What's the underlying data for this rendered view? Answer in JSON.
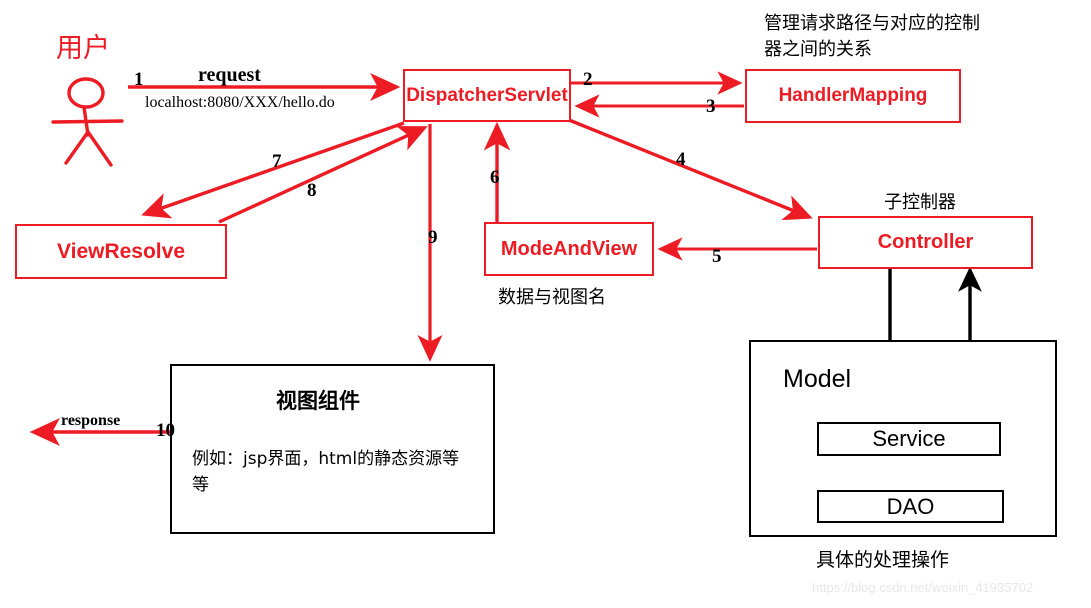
{
  "diagram": {
    "title_watermark": "https://blog.csdn.net/weixin_41935702",
    "colors": {
      "red": "#ED1C24",
      "black": "#000000",
      "background": "#FFFFFF",
      "watermark": "#E8E8E8"
    },
    "actor": {
      "label": "用户",
      "icon": "stick-figure"
    },
    "nodes": {
      "dispatcher_servlet": "DispatcherServlet",
      "handler_mapping": "HandlerMapping",
      "view_resolve": "ViewResolve",
      "mode_and_view": "ModeAndView",
      "controller": "Controller",
      "model": "Model",
      "service": "Service",
      "dao": "DAO",
      "view_component": "视图组件",
      "view_component_desc": "例如：jsp界面，html的静态资源等等"
    },
    "notes": {
      "handler_mapping": "管理请求路径与对应的控制器之间的关系",
      "controller": "子控制器",
      "mode_and_view": "数据与视图名",
      "model": "具体的处理操作",
      "request_url": "localhost:8080/XXX/hello.do"
    },
    "edges": {
      "request_word": "request",
      "response_word": "response",
      "n1": "1",
      "n2": "2",
      "n3": "3",
      "n4": "4",
      "n5": "5",
      "n6": "6",
      "n7": "7",
      "n8": "8",
      "n9": "9",
      "n10": "10"
    }
  }
}
